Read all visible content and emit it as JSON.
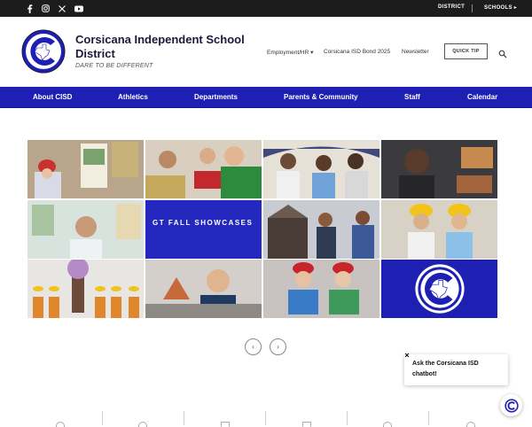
{
  "topbar": {
    "social": [
      "facebook-icon",
      "instagram-icon",
      "x-icon",
      "youtube-icon"
    ],
    "district_label": "DISTRICT",
    "schools_label": "SCHOOLS ▸"
  },
  "header": {
    "school_name": "Corsicana Independent School District",
    "tagline": "DARE TO BE DIFFERENT",
    "links": [
      "Employment/HR ▾",
      "Corsicana ISD Bond 2025",
      "Newsletter"
    ],
    "quick_tip": "QUICK TIP"
  },
  "nav": {
    "items": [
      "About CISD",
      "Athletics",
      "Departments",
      "Parents & Community",
      "Staff",
      "Calendar"
    ]
  },
  "gallery": {
    "showcase_title": "GT FALL SHOWCASES"
  },
  "carousel": {
    "prev": "‹",
    "next": "›"
  },
  "chat": {
    "message": "Ask the Corsicana ISD chatbot!",
    "close": "×"
  },
  "colors": {
    "brand_blue": "#1e20b4",
    "topbar": "#1c1c1c"
  }
}
